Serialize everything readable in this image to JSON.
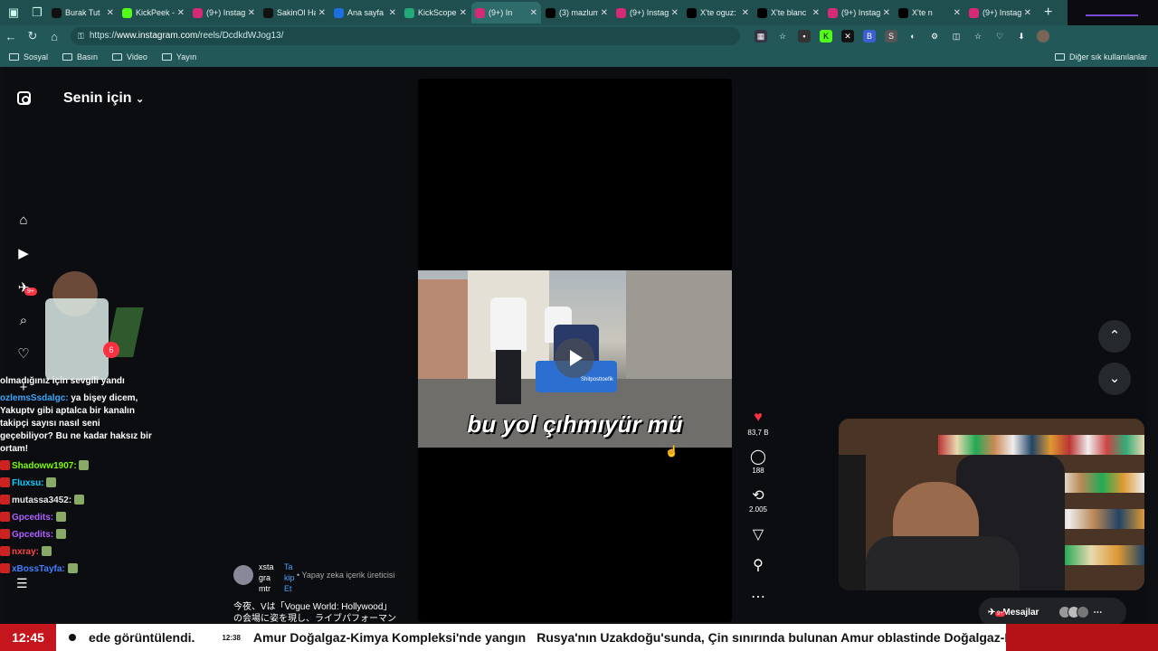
{
  "browser": {
    "tabs": [
      {
        "title": "Burak Tut",
        "color": "#111"
      },
      {
        "title": "KickPeek -",
        "color": "#53fc18"
      },
      {
        "title": "(9+) Instag",
        "color": "#d62976"
      },
      {
        "title": "SakinOl Ha",
        "color": "#111"
      },
      {
        "title": "Ana sayfa",
        "color": "#1d6fe0"
      },
      {
        "title": "KickScope",
        "color": "#2a7"
      },
      {
        "title": "(9+) In",
        "color": "#d62976"
      },
      {
        "title": "(3) mazlum",
        "color": "#000"
      },
      {
        "title": "(9+) Instag",
        "color": "#d62976"
      },
      {
        "title": "X'te oguz:",
        "color": "#000"
      },
      {
        "title": "X'te blanc",
        "color": "#000"
      },
      {
        "title": "(9+) Instag",
        "color": "#d62976"
      },
      {
        "title": "X'te n",
        "color": "#000"
      },
      {
        "title": "(9+) Instag",
        "color": "#d62976"
      }
    ],
    "url_prefix": "https://",
    "url_host": "www.instagram.com",
    "url_path": "/reels/DcdkdWJog13/",
    "bookmarks": [
      "Sosyal",
      "Basın",
      "Video",
      "Yayın"
    ],
    "other_bookmarks": "Diğer sık kullanılanlar"
  },
  "instagram": {
    "feed_title": "Senin için",
    "notif_badge": "9+",
    "reel": {
      "subtitle": "bu yol çıhmıyür mü",
      "watermark": "Shitposttoefik",
      "author_name": "xsta gra mtr",
      "follow_label": "Ta kip Et",
      "meta": "• Yapay zeka içerik üreticisi",
      "caption": "今夜、Vは「Vogue World: Hollywood」の会場に姿を現し、ライブパフォーマンスを"
    },
    "actions": {
      "likes": "83,7 B",
      "comments": "188",
      "reposts": "2.005"
    },
    "messages_label": "Mesajlar",
    "messages_badge": "9+",
    "accent_red": "#ff3040"
  },
  "chat": {
    "lines": [
      {
        "user": "",
        "text": "olmadığınız için sevgili yandı",
        "color": "#ffffff"
      },
      {
        "user": "ozlemsSsdalgc:",
        "text": "ya bişey dicem, Yakuptv gibi aptalca bir kanalın takipçi sayısı nasıl seni geçebiliyor? Bu ne kadar haksız bir ortam!",
        "color": "#3aa8ff"
      },
      {
        "user": "Shadoww1907:",
        "text": "",
        "color": "#7cfc00"
      },
      {
        "user": "Fluxsu:",
        "text": "",
        "color": "#00d0ff"
      },
      {
        "user": "mutassa3452:",
        "text": "",
        "color": "#e8e8e8"
      },
      {
        "user": "Gpcedits:",
        "text": "",
        "color": "#b060ff"
      },
      {
        "user": "Gpcedits:",
        "text": "",
        "color": "#b060ff"
      },
      {
        "user": "nxray:",
        "text": "",
        "color": "#ff4444"
      },
      {
        "user": "xBossTayfa:",
        "text": "",
        "color": "#4080ff"
      }
    ],
    "jar_badge": "6"
  },
  "ticker": {
    "clock": "12:45",
    "text_start": "ede görüntülendi.",
    "time2": "12:38",
    "headline": "Amur Doğalgaz-Kimya Kompleksi'nde yangın",
    "headline2": "Rusya'nın Uzakdoğu'sunda, Çin sınırında bulunan Amur oblastinde Doğalgaz-K"
  }
}
